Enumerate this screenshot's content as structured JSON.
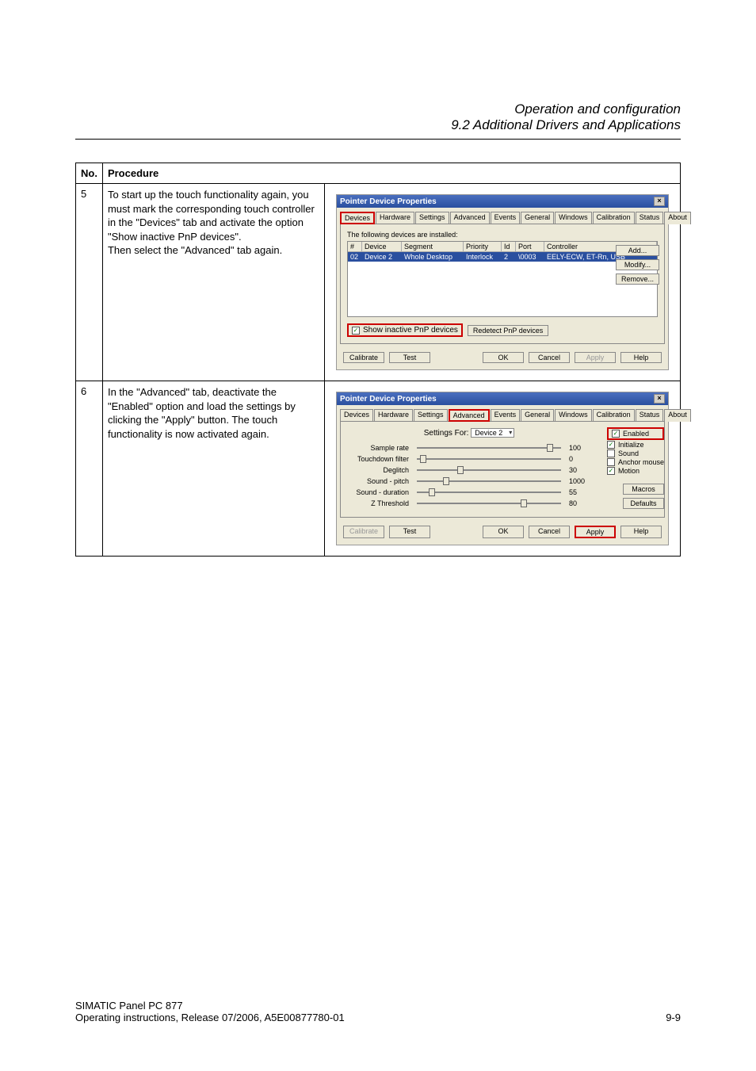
{
  "header": {
    "line1": "Operation and configuration",
    "line2": "9.2 Additional Drivers and Applications"
  },
  "table": {
    "head_no": "No.",
    "head_proc": "Procedure",
    "row5_no": "5",
    "row5_text": "To start up the touch functionality again, you must mark the corresponding touch controller in the \"Devices\" tab and activate the option \"Show inactive PnP devices\".\nThen select the \"Advanced\" tab again.",
    "row6_no": "6",
    "row6_text": "In the \"Advanced\" tab, deactivate the \"Enabled\" option and load the settings by clicking the \"Apply\" button. The touch functionality is now activated again."
  },
  "dlg1": {
    "title": "Pointer Device Properties",
    "tabs": [
      "Devices",
      "Hardware",
      "Settings",
      "Advanced",
      "Events",
      "General",
      "Windows",
      "Calibration",
      "Status",
      "About"
    ],
    "active_tab": "Devices",
    "inner_label": "The following devices are installed:",
    "cols": {
      "hash": "#",
      "device": "Device",
      "segment": "Segment",
      "priority": "Priority",
      "id": "Id",
      "port": "Port",
      "controller": "Controller"
    },
    "row": {
      "hash": "02",
      "device": "Device 2",
      "segment": "Whole Desktop",
      "priority": "Interlock",
      "id": "2",
      "port": "\\0003",
      "controller": "EELY-ECW, ET-Rn, USB"
    },
    "side": {
      "add": "Add...",
      "modify": "Modify...",
      "remove": "Remove..."
    },
    "show_inactive": "Show inactive PnP devices",
    "redetect": "Redetect PnP devices",
    "buttons": {
      "calibrate": "Calibrate",
      "test": "Test",
      "ok": "OK",
      "cancel": "Cancel",
      "apply": "Apply",
      "help": "Help"
    }
  },
  "dlg2": {
    "title": "Pointer Device Properties",
    "tabs": [
      "Devices",
      "Hardware",
      "Settings",
      "Advanced",
      "Events",
      "General",
      "Windows",
      "Calibration",
      "Status",
      "About"
    ],
    "active_tab": "Advanced",
    "settings_for_label": "Settings For:",
    "settings_for_value": "Device 2",
    "sliders": [
      {
        "label": "Sample rate",
        "value": "100",
        "pos": 90
      },
      {
        "label": "Touchdown filter",
        "value": "0",
        "pos": 2
      },
      {
        "label": "Deglitch",
        "value": "30",
        "pos": 28
      },
      {
        "label": "Sound - pitch",
        "value": "1000",
        "pos": 18
      },
      {
        "label": "Sound - duration",
        "value": "55",
        "pos": 8
      },
      {
        "label": "Z Threshold",
        "value": "80",
        "pos": 72
      }
    ],
    "opts": {
      "enabled": "Enabled",
      "initialize": "Initialize",
      "sound": "Sound",
      "anchor": "Anchor mouse",
      "motion": "Motion"
    },
    "rightbtns": {
      "macros": "Macros",
      "defaults": "Defaults"
    },
    "buttons": {
      "calibrate": "Calibrate",
      "test": "Test",
      "ok": "OK",
      "cancel": "Cancel",
      "apply": "Apply",
      "help": "Help"
    }
  },
  "footer": {
    "line1": "SIMATIC Panel PC 877",
    "line2": "Operating instructions, Release 07/2006, A5E00877780-01",
    "page": "9-9"
  }
}
